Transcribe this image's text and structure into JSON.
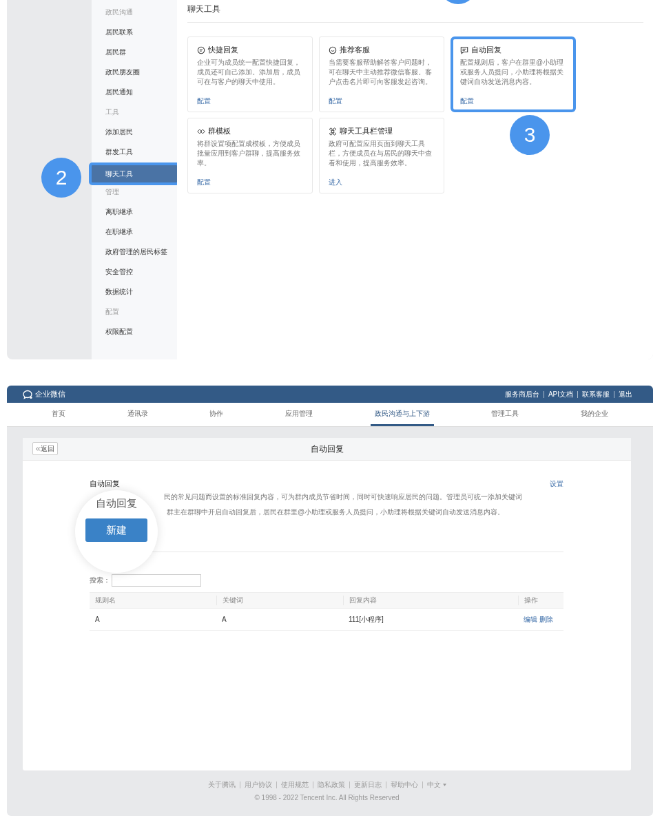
{
  "top_screen": {
    "sidebar": [
      {
        "heading": "政民沟通",
        "items": [
          {
            "label": "居民联系",
            "selected": false
          },
          {
            "label": "居民群",
            "selected": false
          },
          {
            "label": "政民朋友圈",
            "selected": false
          },
          {
            "label": "居民通知",
            "selected": false
          }
        ]
      },
      {
        "heading": "工具",
        "items": [
          {
            "label": "添加居民",
            "selected": false
          },
          {
            "label": "群发工具",
            "selected": false
          },
          {
            "label": "聊天工具",
            "selected": true
          }
        ]
      },
      {
        "heading": "管理",
        "items": [
          {
            "label": "离职继承",
            "selected": false
          },
          {
            "label": "在职继承",
            "selected": false
          },
          {
            "label": "政府管理的居民标签",
            "selected": false
          },
          {
            "label": "安全管控",
            "selected": false
          },
          {
            "label": "数据统计",
            "selected": false
          }
        ]
      },
      {
        "heading": "配置",
        "items": [
          {
            "label": "权限配置",
            "selected": false
          }
        ]
      }
    ],
    "page_title": "聊天工具",
    "tools": [
      {
        "kind": "chat",
        "title": "快捷回复",
        "description": "企业可为成员统一配置快捷回复，成员还可自己添加。添加后，成员可在与客户的聊天中使用。",
        "action": "配置",
        "highlighted": false
      },
      {
        "kind": "service",
        "title": "推荐客服",
        "description": "当需要客服帮助解答客户问题时，可在聊天中主动推荐微信客服。客户点击名片即可向客服发起咨询。",
        "action": "配置",
        "highlighted": false
      },
      {
        "kind": "reply",
        "title": "自动回复",
        "description": "配置规则后，客户在群里@小助理或服务人员提问，小助理将根据关键词自动发送消息内容。",
        "action": "配置",
        "highlighted": true
      },
      {
        "kind": "template",
        "title": "群模板",
        "description": "将群设置项配置成模板，方便成员批量应用到客户群聊，提高服务效率。",
        "action": "配置",
        "highlighted": false
      },
      {
        "kind": "toolbar",
        "title": "聊天工具栏管理",
        "description": "政府可配置应用页面到聊天工具栏，方便成员在与居民的聊天中查看和使用，提高服务效率。",
        "action": "进入",
        "highlighted": false
      }
    ],
    "step_markers": [
      "2",
      "3"
    ]
  },
  "bottom_screen": {
    "logo": "企业微信",
    "header_links": [
      "服务商后台",
      "API文档",
      "联系客服",
      "退出"
    ],
    "nav_tabs": [
      {
        "label": "首页",
        "selected": false
      },
      {
        "label": "通讯录",
        "selected": false
      },
      {
        "label": "协作",
        "selected": false
      },
      {
        "label": "应用管理",
        "selected": false
      },
      {
        "label": "政民沟通与上下游",
        "selected": true
      },
      {
        "label": "管理工具",
        "selected": false
      },
      {
        "label": "我的企业",
        "selected": false
      }
    ],
    "back_button": "返回",
    "panel_title": "自动回复",
    "section_title": "自动回复",
    "settings_link": "设置",
    "description_lines": [
      "民的常见问题而设置的标准回复内容，可为群内成员节省时间，同时可快速响应居民的问题。管理员可统一添加关键词",
      "群主在群聊中开启自动回复后，居民在群里@小助理或服务人员提问，小助理将根据关键词自动发送消息内容。"
    ],
    "magnifier": {
      "text": "自动回复",
      "button": "新建"
    },
    "search_label": "搜索：",
    "table": {
      "columns": [
        "规则名",
        "关键词",
        "回复内容",
        "操作"
      ],
      "rows": [
        {
          "rule": "A",
          "keyword": "A",
          "content": "111[小程序]",
          "actions": [
            "编辑",
            "删除"
          ]
        }
      ]
    },
    "footer_links": [
      "关于腾讯",
      "用户协议",
      "使用规范",
      "隐私政策",
      "更新日志",
      "帮助中心"
    ],
    "language": "中文",
    "copyright": "© 1998 - 2022 Tencent Inc. All Rights Reserved"
  }
}
